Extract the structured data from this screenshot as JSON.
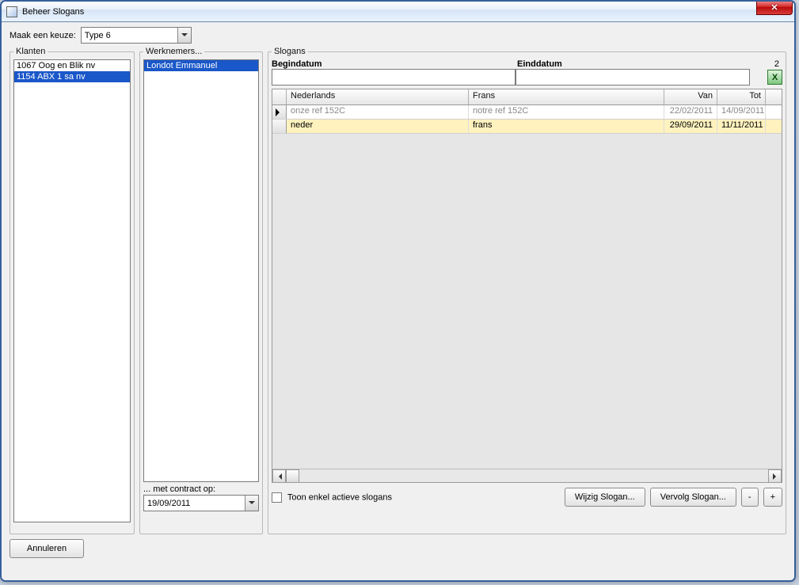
{
  "window": {
    "title": "Beheer Slogans"
  },
  "top": {
    "label": "Maak een keuze:",
    "combo_value": "Type 6"
  },
  "klanten": {
    "legend": "Klanten",
    "items": [
      {
        "text": "1067 Oog en Blik nv",
        "selected": false
      },
      {
        "text": "1154 ABX 1 sa nv",
        "selected": true
      }
    ]
  },
  "werknemers": {
    "legend": "Werknemers...",
    "items": [
      {
        "text": "Londot Emmanuel",
        "selected": true
      }
    ],
    "contract_label": "... met contract op:",
    "contract_date": "19/09/2011"
  },
  "slogans": {
    "legend": "Slogans",
    "begindatum_label": "Begindatum",
    "einddatum_label": "Einddatum",
    "count": "2",
    "begindatum_value": "",
    "einddatum_value": "",
    "excel_icon": "X",
    "columns": {
      "nl": "Nederlands",
      "fr": "Frans",
      "van": "Van",
      "tot": "Tot"
    },
    "rows": [
      {
        "nl": "onze ref 152C",
        "fr": "notre ref 152C",
        "van": "22/02/2011",
        "tot": "14/09/2011",
        "current": true,
        "highlight": false
      },
      {
        "nl": "neder",
        "fr": "frans",
        "van": "29/09/2011",
        "tot": "11/11/2011",
        "current": false,
        "highlight": true
      }
    ],
    "checkbox_label": "Toon enkel actieve slogans",
    "buttons": {
      "wijzig": "Wijzig Slogan...",
      "vervolg": "Vervolg Slogan...",
      "minus": "-",
      "plus": "+"
    }
  },
  "footer": {
    "annuleren": "Annuleren"
  }
}
